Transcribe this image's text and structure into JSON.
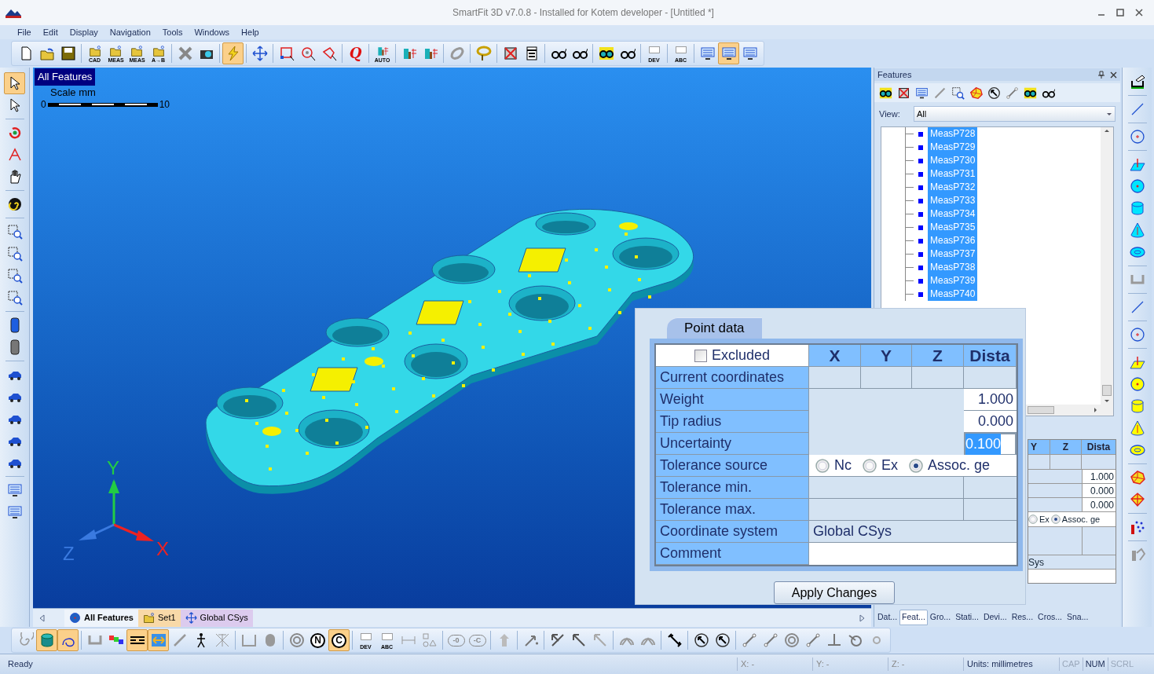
{
  "window": {
    "title": "SmartFit 3D v7.0.8 - Installed for Kotem developer - [Untitled *]"
  },
  "menu": [
    "File",
    "Edit",
    "Display",
    "Navigation",
    "Tools",
    "Windows",
    "Help"
  ],
  "toolbar": [
    {
      "items": [
        {
          "kind": "new",
          "pressed": false
        },
        {
          "kind": "open",
          "pressed": false
        },
        {
          "kind": "save",
          "pressed": false
        }
      ]
    },
    {
      "items": [
        {
          "kind": "folder",
          "label": "CAD",
          "pressed": false
        },
        {
          "kind": "folder",
          "label": "MEAS",
          "pressed": false
        },
        {
          "kind": "folder",
          "label": "MEAS",
          "pressed": false
        },
        {
          "kind": "folder",
          "label": "A→B",
          "pressed": false
        }
      ]
    },
    {
      "items": [
        {
          "kind": "grayx",
          "pressed": false
        },
        {
          "kind": "camera",
          "pressed": false
        }
      ]
    },
    {
      "items": [
        {
          "kind": "bolt",
          "pressed": true
        }
      ]
    },
    {
      "items": [
        {
          "kind": "move",
          "pressed": false
        }
      ]
    },
    {
      "items": [
        {
          "kind": "boxsel",
          "pressed": false
        },
        {
          "kind": "circsel",
          "pressed": false
        },
        {
          "kind": "polysel",
          "pressed": false
        }
      ]
    },
    {
      "items": [
        {
          "kind": "letter",
          "label": "Q",
          "pressed": false
        }
      ]
    },
    {
      "items": [
        {
          "kind": "measure",
          "label": "AUTO",
          "pressed": false
        }
      ]
    },
    {
      "items": [
        {
          "kind": "measure",
          "pressed": false
        },
        {
          "kind": "measure",
          "pressed": false
        }
      ]
    },
    {
      "items": [
        {
          "kind": "ring",
          "pressed": false
        }
      ]
    },
    {
      "items": [
        {
          "kind": "lasso",
          "pressed": false
        }
      ]
    },
    {
      "items": [
        {
          "kind": "xbox",
          "pressed": false
        },
        {
          "kind": "calc",
          "pressed": false
        }
      ]
    },
    {
      "items": [
        {
          "kind": "glasses",
          "pressed": false
        },
        {
          "kind": "glasses",
          "pressed": false
        }
      ]
    },
    {
      "items": [
        {
          "kind": "glassesy",
          "pressed": false
        },
        {
          "kind": "glasses",
          "pressed": false
        }
      ]
    },
    {
      "items": [
        {
          "kind": "tag",
          "label": "DEV",
          "pressed": false
        }
      ]
    },
    {
      "items": [
        {
          "kind": "tag",
          "label": "ABC",
          "pressed": false
        }
      ]
    },
    {
      "items": [
        {
          "kind": "screen",
          "pressed": false
        },
        {
          "kind": "screen",
          "pressed": true
        },
        {
          "kind": "screen",
          "pressed": false
        }
      ]
    }
  ],
  "left_toolbar": [
    {
      "items": [
        {
          "kind": "cursor",
          "pressed": true
        },
        {
          "kind": "cursor",
          "pressed": false
        }
      ]
    },
    {
      "items": [
        {
          "kind": "rotate",
          "pressed": false
        },
        {
          "kind": "wand",
          "pressed": false
        },
        {
          "kind": "hand",
          "pressed": false
        }
      ]
    },
    {
      "items": [
        {
          "kind": "swirl",
          "pressed": false
        }
      ]
    },
    {
      "items": [
        {
          "kind": "zoom",
          "pressed": false
        },
        {
          "kind": "zoom",
          "pressed": false
        },
        {
          "kind": "zoom",
          "pressed": false
        },
        {
          "kind": "zoom",
          "pressed": false
        }
      ]
    },
    {
      "items": [
        {
          "kind": "device",
          "color": "#1e5ee0",
          "pressed": false
        },
        {
          "kind": "device",
          "color": "#777777",
          "pressed": false
        }
      ]
    },
    {
      "items": [
        {
          "kind": "car",
          "pressed": false
        },
        {
          "kind": "car",
          "pressed": false
        },
        {
          "kind": "car",
          "pressed": false
        },
        {
          "kind": "car",
          "pressed": false
        },
        {
          "kind": "car",
          "pressed": false
        }
      ]
    },
    {
      "items": [
        {
          "kind": "screen",
          "pressed": false
        },
        {
          "kind": "screen",
          "pressed": false
        }
      ]
    }
  ],
  "viewport": {
    "label": "All Features",
    "scale": {
      "title": "Scale mm",
      "min": "0",
      "max": "10"
    },
    "axes": {
      "x": "X",
      "y": "Y",
      "z": "Z"
    }
  },
  "viewport_tabs": [
    {
      "label": "All Features",
      "selected": true,
      "color": "#eef4fb"
    },
    {
      "label": "Set1",
      "selected": false,
      "color": "#f8d9a8"
    },
    {
      "label": "Global CSys",
      "selected": false,
      "color": "#dccbee"
    }
  ],
  "features_panel": {
    "title": "Features",
    "view_label": "View:",
    "view_value": "All",
    "tree": [
      {
        "label": "MeasP728",
        "selected": true
      },
      {
        "label": "MeasP729",
        "selected": true
      },
      {
        "label": "MeasP730",
        "selected": true
      },
      {
        "label": "MeasP731",
        "selected": true
      },
      {
        "label": "MeasP732",
        "selected": true
      },
      {
        "label": "MeasP733",
        "selected": true
      },
      {
        "label": "MeasP734",
        "selected": true
      },
      {
        "label": "MeasP735",
        "selected": true
      },
      {
        "label": "MeasP736",
        "selected": true
      },
      {
        "label": "MeasP737",
        "selected": true
      },
      {
        "label": "MeasP738",
        "selected": true
      },
      {
        "label": "MeasP739",
        "selected": true
      },
      {
        "label": "MeasP740",
        "selected": true
      }
    ],
    "docked_table": {
      "columns": [
        "Y",
        "Z",
        "Dista"
      ],
      "values": [
        "1.000",
        "0.000",
        "0.000"
      ],
      "options": [
        {
          "label": "Ex",
          "selected": false
        },
        {
          "label": "Assoc. ge",
          "selected": true
        }
      ],
      "system": "Sys"
    },
    "tabs": [
      {
        "label": "Dat...",
        "selected": false
      },
      {
        "label": "Feat...",
        "selected": true
      },
      {
        "label": "Gro...",
        "selected": false
      },
      {
        "label": "Stati...",
        "selected": false
      },
      {
        "label": "Devi...",
        "selected": false
      },
      {
        "label": "Res...",
        "selected": false
      },
      {
        "label": "Cros...",
        "selected": false
      },
      {
        "label": "Sna...",
        "selected": false
      }
    ]
  },
  "right_toolbar": [
    {
      "items": [
        {
          "kind": "handplane",
          "pressed": false
        }
      ]
    },
    {
      "items": [
        {
          "kind": "line",
          "pressed": false
        }
      ]
    },
    {
      "items": [
        {
          "kind": "circle",
          "pressed": false
        }
      ]
    },
    {
      "items": [
        {
          "kind": "plane",
          "color": "#00e5ff",
          "pressed": false
        },
        {
          "kind": "sphere",
          "color": "#00e5ff",
          "pressed": false
        },
        {
          "kind": "cylinder",
          "color": "#00e5ff",
          "pressed": false
        },
        {
          "kind": "cone",
          "color": "#00e5ff",
          "pressed": false
        },
        {
          "kind": "torus",
          "color": "#00e5ff",
          "pressed": false
        }
      ]
    },
    {
      "items": [
        {
          "kind": "bracket",
          "pressed": false
        }
      ]
    },
    {
      "items": [
        {
          "kind": "line",
          "pressed": false
        }
      ]
    },
    {
      "items": [
        {
          "kind": "circle",
          "pressed": false
        }
      ]
    },
    {
      "items": [
        {
          "kind": "plane",
          "color": "#ffff00",
          "pressed": false
        },
        {
          "kind": "sphere",
          "color": "#ffff00",
          "pressed": false
        },
        {
          "kind": "cylinder",
          "color": "#ffff00",
          "pressed": false
        },
        {
          "kind": "cone",
          "color": "#ffff00",
          "pressed": false
        },
        {
          "kind": "torus",
          "color": "#ffff00",
          "pressed": false
        }
      ]
    },
    {
      "items": [
        {
          "kind": "poly",
          "pressed": false
        },
        {
          "kind": "diamond",
          "pressed": false
        }
      ]
    },
    {
      "items": [
        {
          "kind": "dots",
          "pressed": false
        }
      ]
    },
    {
      "items": [
        {
          "kind": "probe",
          "pressed": false
        }
      ]
    }
  ],
  "point_data": {
    "tab": "Point data",
    "excluded": {
      "label": "Excluded",
      "checked": false
    },
    "columns": [
      "X",
      "Y",
      "Z",
      "Dista"
    ],
    "rows": [
      {
        "kind": "cells",
        "label": "Current coordinates"
      },
      {
        "kind": "value",
        "label": "Weight",
        "value": "1.000",
        "editing": false
      },
      {
        "kind": "value",
        "label": "Tip radius",
        "value": "0.000",
        "editing": false
      },
      {
        "kind": "value",
        "label": "Uncertainty",
        "value": "0.100",
        "editing": true
      },
      {
        "kind": "radio",
        "label": "Tolerance source",
        "options": [
          {
            "label": "Nc",
            "selected": false
          },
          {
            "label": "Ex",
            "selected": false
          },
          {
            "label": "Assoc. ge",
            "selected": true
          }
        ]
      },
      {
        "kind": "blank",
        "label": "Tolerance min."
      },
      {
        "kind": "blank",
        "label": "Tolerance max."
      },
      {
        "kind": "text",
        "label": "Coordinate system",
        "value": "Global CSys"
      },
      {
        "kind": "field",
        "label": "Comment"
      }
    ],
    "button": "Apply Changes"
  },
  "bottom_toolbar": [
    {
      "items": [
        {
          "kind": "spiral",
          "pressed": false
        },
        {
          "kind": "cyl2",
          "pressed": true
        },
        {
          "kind": "curve",
          "pressed": true
        }
      ]
    },
    {
      "items": [
        {
          "kind": "bracket",
          "pressed": false
        },
        {
          "kind": "rainbow",
          "pressed": false
        },
        {
          "kind": "bars",
          "pressed": true
        },
        {
          "kind": "arrows",
          "pressed": true
        },
        {
          "kind": "stick",
          "pressed": false
        },
        {
          "kind": "figure",
          "pressed": false
        },
        {
          "kind": "net",
          "pressed": false
        }
      ]
    },
    {
      "items": [
        {
          "kind": "basket",
          "pressed": false
        },
        {
          "kind": "pill",
          "pressed": false
        }
      ]
    },
    {
      "items": [
        {
          "kind": "target",
          "pressed": false
        },
        {
          "kind": "lettercircle",
          "label": "N",
          "pressed": false
        },
        {
          "kind": "lettercircle",
          "label": "C",
          "pressed": true
        }
      ]
    },
    {
      "items": [
        {
          "kind": "tag",
          "label": "DEV",
          "pressed": false
        },
        {
          "kind": "tag",
          "label": "ABC",
          "pressed": false
        },
        {
          "kind": "dim",
          "pressed": false
        },
        {
          "kind": "shapes",
          "pressed": false
        }
      ]
    },
    {
      "items": [
        {
          "kind": "oval",
          "label": "-0",
          "pressed": false
        },
        {
          "kind": "oval",
          "label": "-C",
          "pressed": false
        }
      ]
    },
    {
      "items": [
        {
          "kind": "arrowup",
          "pressed": false
        }
      ]
    },
    {
      "items": [
        {
          "kind": "arrowpm",
          "pressed": false
        }
      ]
    },
    {
      "items": [
        {
          "kind": "arrow2",
          "pressed": false
        },
        {
          "kind": "arrow",
          "pressed": false
        },
        {
          "kind": "arrowfade",
          "pressed": false
        }
      ]
    },
    {
      "items": [
        {
          "kind": "fan",
          "pressed": false
        },
        {
          "kind": "fan",
          "pressed": false
        }
      ]
    },
    {
      "items": [
        {
          "kind": "dimline",
          "pressed": false
        }
      ]
    },
    {
      "items": [
        {
          "kind": "dial",
          "pressed": false
        },
        {
          "kind": "dial",
          "pressed": false
        }
      ]
    },
    {
      "items": [
        {
          "kind": "seg",
          "pressed": false
        },
        {
          "kind": "seg",
          "pressed": false
        },
        {
          "kind": "target",
          "pressed": false
        },
        {
          "kind": "seg",
          "pressed": false
        },
        {
          "kind": "perp",
          "pressed": false
        },
        {
          "kind": "ringline",
          "pressed": false
        },
        {
          "kind": "small",
          "pressed": false
        }
      ]
    }
  ],
  "status_bar": {
    "message": "Ready",
    "x": "X: -",
    "y": "Y: -",
    "z": "Z: -",
    "units": "Units: millimetres",
    "indicators": [
      {
        "label": "CAP",
        "on": false
      },
      {
        "label": "NUM",
        "on": true
      },
      {
        "label": "SCRL",
        "on": false
      }
    ]
  }
}
